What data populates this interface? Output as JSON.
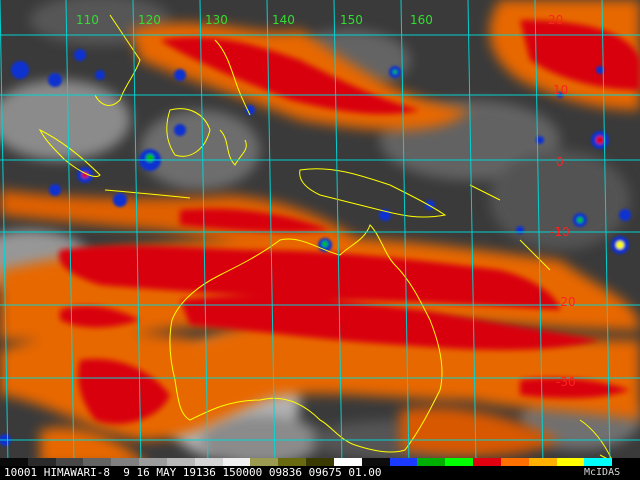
{
  "map": {
    "satellite": "HIMAWARI-8",
    "colors": {
      "background": "#000000",
      "gridline": "#00d8d8",
      "coastline": "#ffff00",
      "lon_label": "#33dd33",
      "lat_label": "#ff2222",
      "cloud_warm": "#f07000",
      "cloud_hot": "#e00010",
      "deep_convection": "#1030d0"
    },
    "lon_labels": [
      "110",
      "120",
      "130",
      "140",
      "150",
      "160"
    ],
    "lat_labels": [
      "20",
      "10",
      "0",
      "-10",
      "-20",
      "-30"
    ]
  },
  "status": {
    "line": "10001 HIMAWARI-8  9 16 MAY 19136 150000 09836 09675 01.00",
    "brand": "McIDAS"
  },
  "colorbar": {
    "colors": [
      "#0a0a0a",
      "#2a2a2a",
      "#474747",
      "#646464",
      "#808080",
      "#9c9c9c",
      "#b8b8b8",
      "#d4d4d4",
      "#f0f0f0",
      "#9a9a50",
      "#6a6a10",
      "#3a3a00",
      "#ffffff",
      "#0c0c0c",
      "#1a3aff",
      "#00b000",
      "#00ff00",
      "#e00010",
      "#ff7000",
      "#ffb000",
      "#ffff00",
      "#00ffff",
      "#000000"
    ]
  }
}
